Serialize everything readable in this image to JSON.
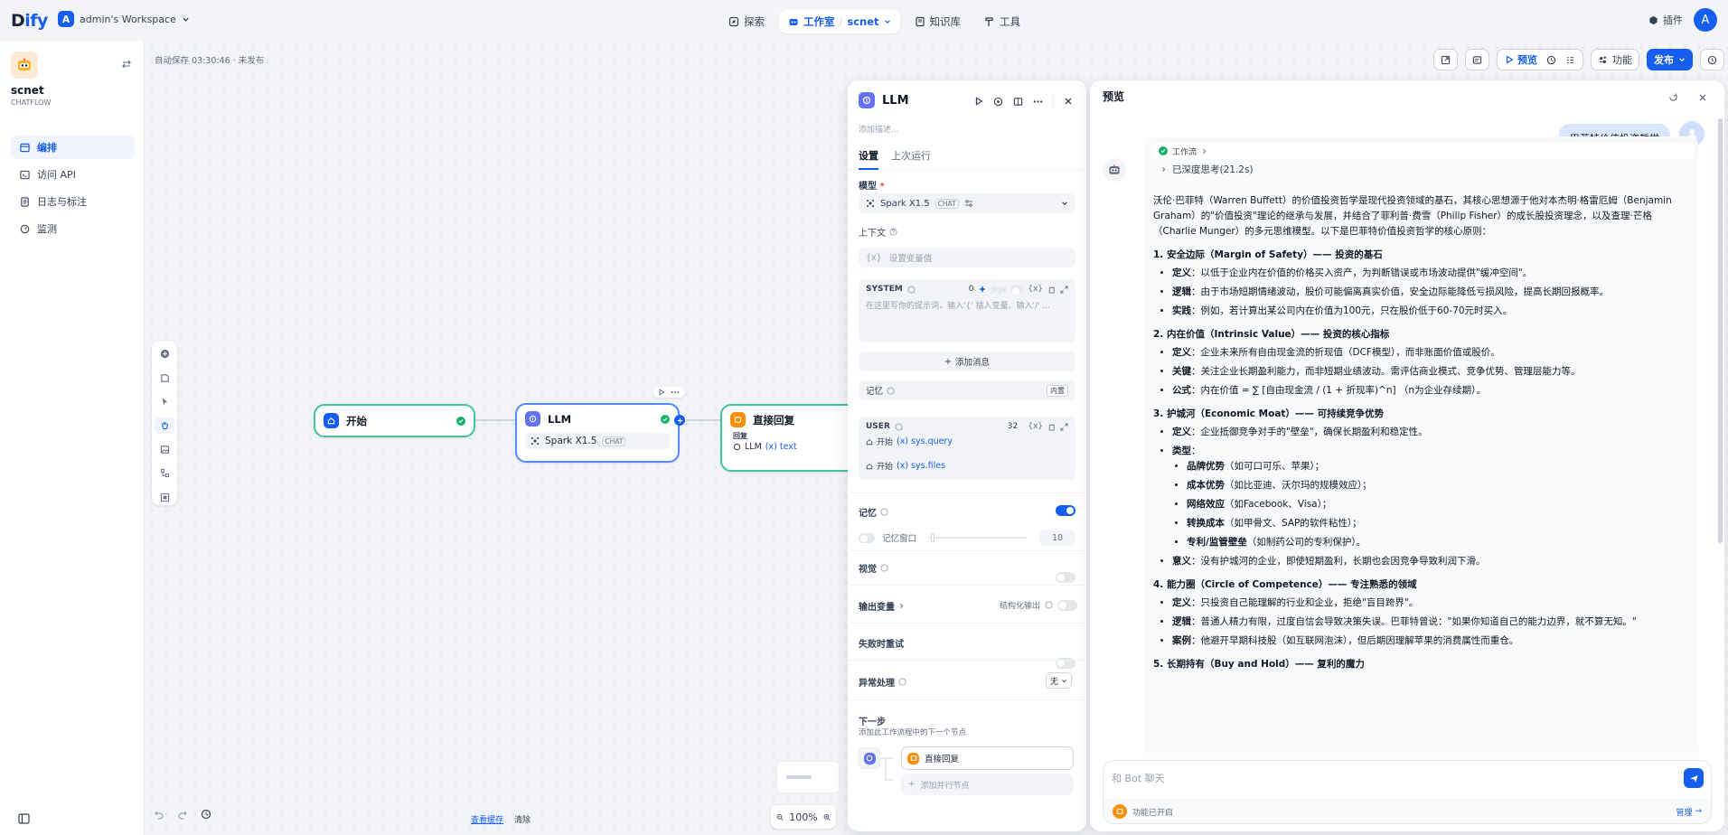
{
  "brand": {
    "logo_prefix": "D",
    "logo_suffix": "ify"
  },
  "workspace": {
    "avatar": "A",
    "name": "admin's Workspace"
  },
  "nav": {
    "explore": "探索",
    "studio": "工作室",
    "app": "scnet",
    "knowledge": "知识库",
    "tools": "工具"
  },
  "plugin": "插件",
  "user_avatar": "A",
  "app": {
    "name": "scnet",
    "type": "CHATFLOW"
  },
  "sidebar": {
    "items": [
      {
        "label": "编排"
      },
      {
        "label": "访问 API"
      },
      {
        "label": "日志与标注"
      },
      {
        "label": "监测"
      }
    ]
  },
  "canvas": {
    "autosave": "自动保存 03:30:46 · 未发布",
    "toolbar": {
      "preview": "预览",
      "features": "功能",
      "publish": "发布"
    },
    "nodes": {
      "start": {
        "title": "开始"
      },
      "llm": {
        "title": "LLM",
        "model": "Spark X1.5",
        "model_tag": "CHAT"
      },
      "answer": {
        "title": "直接回复",
        "field": "回复",
        "ref_node": "LLM",
        "ref_var": "text"
      }
    },
    "bottom": {
      "view_snapshot": "查看缓存",
      "clear": "清除"
    },
    "zoom": "100%"
  },
  "llm_panel": {
    "title": "LLM",
    "desc_placeholder": "添加描述...",
    "tabs": {
      "settings": "设置",
      "last_run": "上次运行"
    },
    "model_label": "模型",
    "model_name": "Spark X1.5",
    "model_tag": "CHAT",
    "context_label": "上下文",
    "context_placeholder": "设置变量值",
    "system": {
      "label": "SYSTEM",
      "count": "0",
      "jinja": "Jinja",
      "placeholder": "在这里写你的提示词，输入'{' 插入变量、输入'/' ..."
    },
    "add_message": "添加消息",
    "memory_section": {
      "label": "记忆",
      "builtin": "内置"
    },
    "user": {
      "label": "USER",
      "count": "32",
      "rows": [
        {
          "node": "开始",
          "var": "sys.query"
        },
        {
          "node": "开始",
          "var": "sys.files"
        }
      ]
    },
    "memory": {
      "label": "记忆",
      "enabled": true,
      "window_label": "记忆窗口",
      "window_value": "10",
      "window_enabled": false
    },
    "vision": {
      "label": "视觉"
    },
    "output_vars": {
      "label": "输出变量",
      "structured": "结构化输出"
    },
    "retry": {
      "label": "失败时重试"
    },
    "error": {
      "label": "异常处理",
      "value": "无"
    },
    "next": {
      "label": "下一步",
      "desc": "添加此工作流程中的下一个节点",
      "node": "直接回复",
      "add_parallel": "添加并行节点"
    }
  },
  "preview": {
    "title": "预览",
    "user_message": "巴菲特价值投资哲学",
    "workflow_label": "工作流",
    "thinking": "已深度思考(21.2s)",
    "intro": "沃伦·巴菲特（Warren Buffett）的价值投资哲学是现代投资领域的基石，其核心思想源于他对本杰明·格雷厄姆（Benjamin Graham）的\"价值投资\"理论的继承与发展，并结合了菲利普·费雪（Philip Fisher）的成长股投资理念，以及查理·芒格（Charlie Munger）的多元思维模型。以下是巴菲特价值投资哲学的核心原则：",
    "sections": [
      {
        "heading": "1. 安全边际（Margin of Safety）—— 投资的基石",
        "items": [
          {
            "term": "定义",
            "text": "：以低于企业内在价值的价格买入资产，为判断错误或市场波动提供\"缓冲空间\"。"
          },
          {
            "term": "逻辑",
            "text": "：由于市场短期情绪波动，股价可能偏离真实价值，安全边际能降低亏损风险，提高长期回报概率。"
          },
          {
            "term": "实践",
            "text": "：例如，若计算出某公司内在价值为100元，只在股价低于60-70元时买入。"
          }
        ]
      },
      {
        "heading": "2. 内在价值（Intrinsic Value）—— 投资的核心指标",
        "items": [
          {
            "term": "定义",
            "text": "：企业未来所有自由现金流的折现值（DCF模型），而非账面价值或股价。"
          },
          {
            "term": "关键",
            "text": "：关注企业长期盈利能力，而非短期业绩波动。需评估商业模式、竞争优势、管理层能力等。"
          },
          {
            "term": "公式",
            "text": "：内在价值 = ∑ [自由现金流 / (1 + 折现率)^n] （n为企业存续期）。"
          }
        ]
      },
      {
        "heading": "3. 护城河（Economic Moat）—— 可持续竞争优势",
        "items": [
          {
            "term": "定义",
            "text": "：企业抵御竞争对手的\"壁垒\"，确保长期盈利和稳定性。"
          },
          {
            "term": "类型",
            "text": "："
          }
        ],
        "subitems": [
          {
            "term": "品牌优势",
            "text": "（如可口可乐、苹果）；"
          },
          {
            "term": "成本优势",
            "text": "（如比亚迪、沃尔玛的规模效应）；"
          },
          {
            "term": "网络效应",
            "text": "（如Facebook、Visa）；"
          },
          {
            "term": "转换成本",
            "text": "（如甲骨文、SAP的软件粘性）；"
          },
          {
            "term": "专利/监管壁垒",
            "text": "（如制药公司的专利保护）。"
          }
        ],
        "after": [
          {
            "term": "意义",
            "text": "：没有护城河的企业，即使短期盈利，长期也会因竞争导致利润下滑。"
          }
        ]
      },
      {
        "heading": "4. 能力圈（Circle of Competence）—— 专注熟悉的领域",
        "items": [
          {
            "term": "定义",
            "text": "：只投资自己能理解的行业和企业，拒绝\"盲目跨界\"。"
          },
          {
            "term": "逻辑",
            "text": "：普通人精力有限，过度自信会导致决策失误。巴菲特曾说：\"如果你知道自己的能力边界，就不算无知。\""
          },
          {
            "term": "案例",
            "text": "：他避开早期科技股（如互联网泡沫），但后期因理解苹果的消费属性而重仓。"
          }
        ]
      },
      {
        "heading": "5. 长期持有（Buy and Hold）—— 复利的魔力",
        "items": []
      }
    ],
    "chat_placeholder": "和 Bot 聊天",
    "features_on": "功能已开启",
    "manage": "管理"
  }
}
